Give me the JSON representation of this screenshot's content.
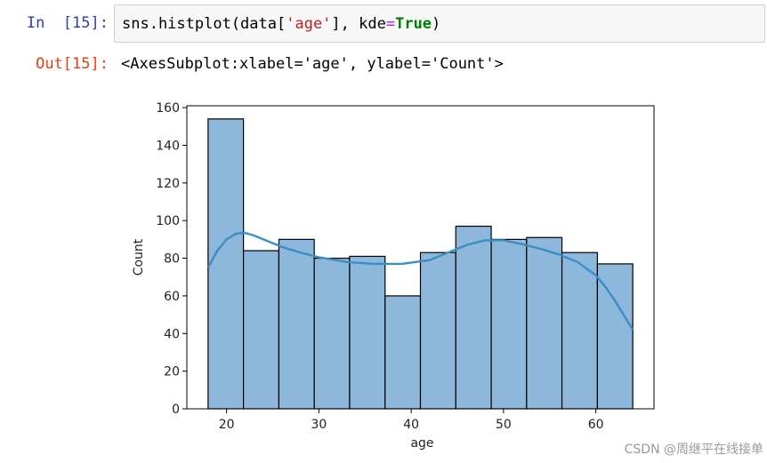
{
  "cell": {
    "in_prompt": "In  [15]:",
    "code": {
      "part1": "sns.histplot(data[",
      "str": "'age'",
      "part2": "], kde",
      "op": "=",
      "kw": "True",
      "part3": ")"
    },
    "out_prompt": "Out[15]:",
    "output_text": "<AxesSubplot:xlabel='age', ylabel='Count'>"
  },
  "watermark": "CSDN @周继平在线接单",
  "colors": {
    "bar_fill": "#8db8db",
    "bar_edge": "#000000",
    "kde_line": "#3b8ec2"
  },
  "chart_data": {
    "type": "bar",
    "xlabel": "age",
    "ylabel": "Count",
    "xlim": [
      15.7,
      66.3
    ],
    "ylim": [
      0,
      161
    ],
    "xticks": [
      20,
      30,
      40,
      50,
      60
    ],
    "yticks": [
      0,
      20,
      40,
      60,
      80,
      100,
      120,
      140,
      160
    ],
    "bin_edges": [
      18,
      21.83,
      25.67,
      29.5,
      33.33,
      37.17,
      41,
      44.83,
      48.67,
      52.5,
      56.33,
      60.17,
      64
    ],
    "counts": [
      154,
      84,
      90,
      80,
      81,
      60,
      83,
      97,
      90,
      91,
      83,
      77
    ],
    "kde": {
      "x": [
        18,
        19,
        20,
        21,
        22,
        23,
        24,
        26,
        28,
        30,
        33,
        36,
        39,
        42,
        44,
        46,
        48,
        50,
        52,
        54,
        56,
        58,
        60,
        61,
        62,
        63,
        64
      ],
      "y": [
        75,
        84,
        90,
        93,
        93.5,
        92,
        90,
        86,
        83,
        80.5,
        78,
        77,
        77,
        79,
        83,
        87,
        89.5,
        89.5,
        87.5,
        85,
        82,
        78,
        71,
        65,
        58,
        50,
        42
      ]
    }
  }
}
